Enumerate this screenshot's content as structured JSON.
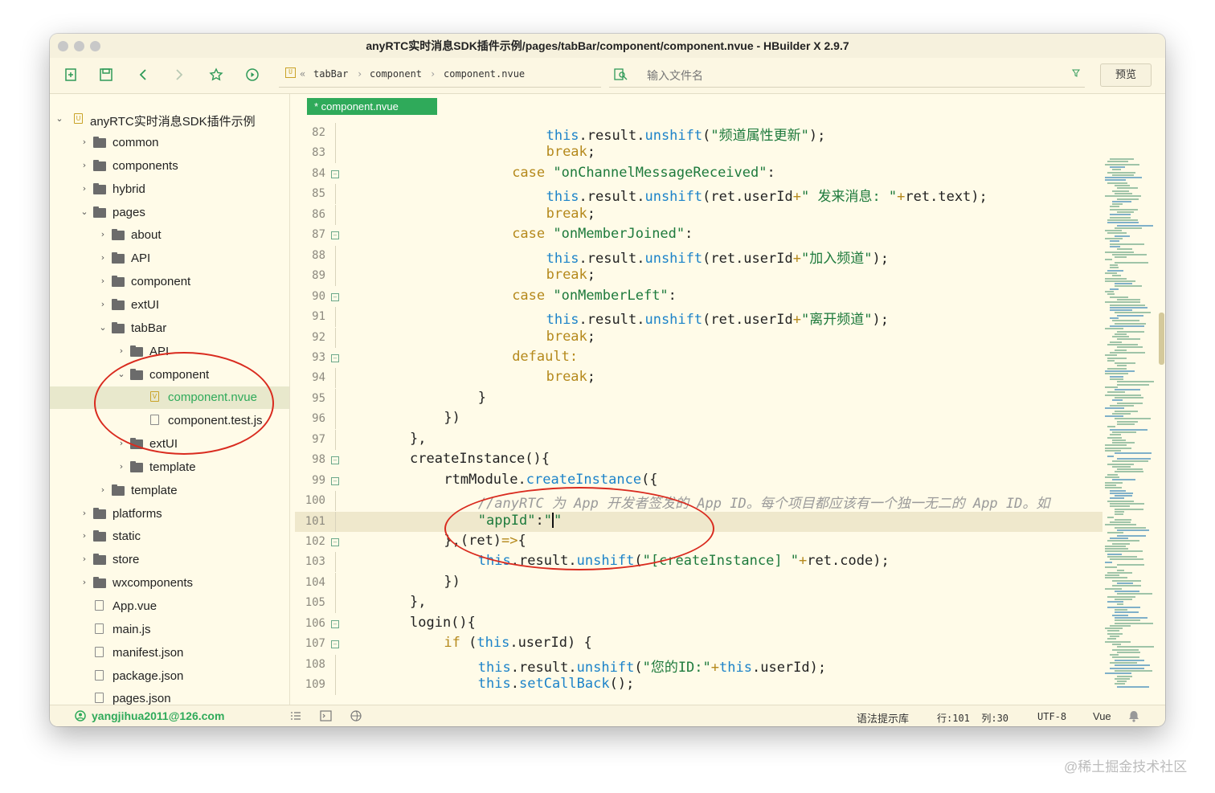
{
  "window": {
    "title": "anyRTC实时消息SDK插件示例/pages/tabBar/component/component.nvue - HBuilder X 2.9.7"
  },
  "toolbar": {
    "breadcrumb": [
      "tabBar",
      "component",
      "component.nvue"
    ],
    "file_search_placeholder": "输入文件名",
    "preview_label": "预览",
    "icons": [
      "new-file-icon",
      "save-icon",
      "back-icon",
      "forward-icon",
      "star-icon",
      "run-icon"
    ]
  },
  "sidebar": {
    "project": "anyRTC实时消息SDK插件示例",
    "items": [
      {
        "label": "common",
        "type": "folder",
        "expanded": false,
        "level": 1
      },
      {
        "label": "components",
        "type": "folder",
        "expanded": false,
        "level": 1
      },
      {
        "label": "hybrid",
        "type": "folder",
        "expanded": false,
        "level": 1
      },
      {
        "label": "pages",
        "type": "folder",
        "expanded": true,
        "level": 1
      },
      {
        "label": "about",
        "type": "folder",
        "expanded": false,
        "level": 2
      },
      {
        "label": "API",
        "type": "folder",
        "expanded": false,
        "level": 2
      },
      {
        "label": "component",
        "type": "folder",
        "expanded": false,
        "level": 2
      },
      {
        "label": "extUI",
        "type": "folder",
        "expanded": false,
        "level": 2
      },
      {
        "label": "tabBar",
        "type": "folder",
        "expanded": true,
        "level": 2
      },
      {
        "label": "API",
        "type": "folder",
        "expanded": false,
        "level": 3
      },
      {
        "label": "component",
        "type": "folder",
        "expanded": true,
        "level": 3
      },
      {
        "label": "component.nvue",
        "type": "file",
        "level": 4,
        "selected": true
      },
      {
        "label": "component.test.js",
        "type": "file",
        "level": 4
      },
      {
        "label": "extUI",
        "type": "folder",
        "expanded": false,
        "level": 3
      },
      {
        "label": "template",
        "type": "folder",
        "expanded": false,
        "level": 3
      },
      {
        "label": "template",
        "type": "folder",
        "expanded": false,
        "level": 2
      },
      {
        "label": "platforms",
        "type": "folder",
        "expanded": false,
        "level": 1
      },
      {
        "label": "static",
        "type": "folder",
        "expanded": false,
        "level": 1
      },
      {
        "label": "store",
        "type": "folder",
        "expanded": false,
        "level": 1
      },
      {
        "label": "wxcomponents",
        "type": "folder",
        "expanded": false,
        "level": 1
      },
      {
        "label": "App.vue",
        "type": "file",
        "level": 1
      },
      {
        "label": "main.js",
        "type": "file",
        "level": 1
      },
      {
        "label": "manifest.json",
        "type": "file",
        "level": 1
      },
      {
        "label": "package.json",
        "type": "file",
        "level": 1
      },
      {
        "label": "pages.json",
        "type": "file",
        "level": 1
      }
    ]
  },
  "editor": {
    "tab_label": "* component.nvue",
    "lines": [
      {
        "n": "82",
        "fold": false,
        "indent": 8,
        "tokens": [
          [
            "this",
            "this"
          ],
          [
            ".",
            "p"
          ],
          [
            "result",
            "d"
          ],
          [
            ".",
            "p"
          ],
          [
            "unshift",
            "fn"
          ],
          [
            "(",
            "d"
          ],
          [
            "\"频道属性更新\"",
            "str"
          ],
          [
            ");",
            "d"
          ]
        ]
      },
      {
        "n": "83",
        "fold": false,
        "indent": 8,
        "tokens": [
          [
            "break",
            "kw"
          ],
          [
            ";",
            "d"
          ]
        ]
      },
      {
        "n": "84",
        "fold": true,
        "indent": 6,
        "tokens": [
          [
            "case ",
            "kw"
          ],
          [
            "\"onChannelMessageReceived\"",
            "str"
          ],
          [
            ":",
            "d"
          ]
        ]
      },
      {
        "n": "85",
        "fold": false,
        "indent": 8,
        "tokens": [
          [
            "this",
            "this"
          ],
          [
            ".",
            "p"
          ],
          [
            "result",
            "d"
          ],
          [
            ".",
            "p"
          ],
          [
            "unshift",
            "fn"
          ],
          [
            "(ret.userId",
            "d"
          ],
          [
            "+",
            "kw"
          ],
          [
            "\" 发来消息: \"",
            "str"
          ],
          [
            "+",
            "kw"
          ],
          [
            "ret.text);",
            "d"
          ]
        ]
      },
      {
        "n": "86",
        "fold": false,
        "indent": 8,
        "tokens": [
          [
            "break",
            "kw"
          ],
          [
            ";",
            "d"
          ]
        ]
      },
      {
        "n": "87",
        "fold": true,
        "indent": 6,
        "tokens": [
          [
            "case ",
            "kw"
          ],
          [
            "\"onMemberJoined\"",
            "str"
          ],
          [
            ":",
            "d"
          ]
        ]
      },
      {
        "n": "88",
        "fold": false,
        "indent": 8,
        "tokens": [
          [
            "this",
            "this"
          ],
          [
            ".",
            "p"
          ],
          [
            "result",
            "d"
          ],
          [
            ".",
            "p"
          ],
          [
            "unshift",
            "fn"
          ],
          [
            "(ret.userId",
            "d"
          ],
          [
            "+",
            "kw"
          ],
          [
            "\"加入频道\"",
            "str"
          ],
          [
            ");",
            "d"
          ]
        ]
      },
      {
        "n": "89",
        "fold": false,
        "indent": 8,
        "tokens": [
          [
            "break",
            "kw"
          ],
          [
            ";",
            "d"
          ]
        ]
      },
      {
        "n": "90",
        "fold": true,
        "indent": 6,
        "tokens": [
          [
            "case ",
            "kw"
          ],
          [
            "\"onMemberLeft\"",
            "str"
          ],
          [
            ":",
            "d"
          ]
        ]
      },
      {
        "n": "91",
        "fold": false,
        "indent": 8,
        "tokens": [
          [
            "this",
            "this"
          ],
          [
            ".",
            "p"
          ],
          [
            "result",
            "d"
          ],
          [
            ".",
            "p"
          ],
          [
            "unshift",
            "fn"
          ],
          [
            "(ret.userId",
            "d"
          ],
          [
            "+",
            "kw"
          ],
          [
            "\"离开频道\"",
            "str"
          ],
          [
            ");",
            "d"
          ]
        ]
      },
      {
        "n": "92",
        "fold": false,
        "indent": 8,
        "tokens": [
          [
            "break",
            "kw"
          ],
          [
            ";",
            "d"
          ]
        ]
      },
      {
        "n": "93",
        "fold": true,
        "indent": 6,
        "tokens": [
          [
            "default:",
            "kw"
          ]
        ]
      },
      {
        "n": "94",
        "fold": false,
        "indent": 8,
        "tokens": [
          [
            "break",
            "kw"
          ],
          [
            ";",
            "d"
          ]
        ]
      },
      {
        "n": "95",
        "fold": false,
        "indent": 4,
        "tokens": [
          [
            "}",
            "d"
          ]
        ]
      },
      {
        "n": "96",
        "fold": false,
        "indent": 2,
        "tokens": [
          [
            "})",
            "d"
          ]
        ]
      },
      {
        "n": "97",
        "fold": false,
        "indent": 0,
        "tokens": [
          [
            "},",
            "d"
          ]
        ]
      },
      {
        "n": "98",
        "fold": true,
        "indent": 0,
        "tokens": [
          [
            "createInstance(){",
            "d"
          ]
        ]
      },
      {
        "n": "99",
        "fold": true,
        "indent": 2,
        "tokens": [
          [
            "rtmModule",
            "d"
          ],
          [
            ".",
            "p"
          ],
          [
            "createInstance",
            "fn"
          ],
          [
            "({",
            "d"
          ]
        ]
      },
      {
        "n": "100",
        "fold": false,
        "indent": 4,
        "tokens": [
          [
            "//anyRTC 为 App 开发者签发的 App ID。每个项目都应该有一个独一无二的 App ID。如",
            "cmt"
          ]
        ]
      },
      {
        "n": "101",
        "fold": false,
        "indent": 4,
        "current": true,
        "tokens": [
          [
            "\"appId\"",
            "str"
          ],
          [
            ":",
            "d"
          ],
          [
            "\"|\"",
            "str"
          ]
        ]
      },
      {
        "n": "102",
        "fold": true,
        "indent": 2,
        "tokens": [
          [
            "},(ret)",
            "d"
          ],
          [
            "=>",
            "kw"
          ],
          [
            "{",
            "d"
          ]
        ]
      },
      {
        "n": "103",
        "fold": false,
        "indent": 4,
        "tokens": [
          [
            "this",
            "this"
          ],
          [
            ".",
            "p"
          ],
          [
            "result",
            "d"
          ],
          [
            ".",
            "p"
          ],
          [
            "unshift",
            "fn"
          ],
          [
            "(",
            "d"
          ],
          [
            "\"[createInstance] \"",
            "str"
          ],
          [
            "+",
            "kw"
          ],
          [
            "ret",
            "d"
          ],
          [
            ".",
            "p"
          ],
          [
            "code);",
            "d"
          ]
        ]
      },
      {
        "n": "104",
        "fold": false,
        "indent": 2,
        "tokens": [
          [
            "})",
            "d"
          ]
        ]
      },
      {
        "n": "105",
        "fold": false,
        "indent": 0,
        "tokens": [
          [
            "},",
            "d"
          ]
        ]
      },
      {
        "n": "106",
        "fold": true,
        "indent": 0,
        "tokens": [
          [
            "login(){",
            "d"
          ]
        ]
      },
      {
        "n": "107",
        "fold": true,
        "indent": 2,
        "tokens": [
          [
            "if ",
            "kw"
          ],
          [
            "(",
            "d"
          ],
          [
            "this",
            "this"
          ],
          [
            ".",
            "p"
          ],
          [
            "userId) {",
            "d"
          ]
        ]
      },
      {
        "n": "108",
        "fold": false,
        "indent": 4,
        "tokens": [
          [
            "this",
            "this"
          ],
          [
            ".",
            "p"
          ],
          [
            "result",
            "d"
          ],
          [
            ".",
            "p"
          ],
          [
            "unshift",
            "fn"
          ],
          [
            "(",
            "d"
          ],
          [
            "\"您的ID:\"",
            "str"
          ],
          [
            "+",
            "kw"
          ],
          [
            "this",
            "this"
          ],
          [
            ".",
            "p"
          ],
          [
            "userId);",
            "d"
          ]
        ]
      },
      {
        "n": "109",
        "fold": false,
        "indent": 4,
        "tokens": [
          [
            "this",
            "this"
          ],
          [
            ".",
            "p"
          ],
          [
            "setCallBack",
            "fn"
          ],
          [
            "();",
            "d"
          ]
        ]
      }
    ]
  },
  "statusbar": {
    "user": "yangjihua2011@126.com",
    "syntax_lib": "语法提示库",
    "cursor": "行:101  列:30",
    "encoding": "UTF-8",
    "language": "Vue"
  },
  "watermark": "@稀土掘金技术社区",
  "colors": {
    "accent_green": "#2faa5a",
    "annotation_red": "#d92b1f",
    "background": "#fffbe8"
  }
}
